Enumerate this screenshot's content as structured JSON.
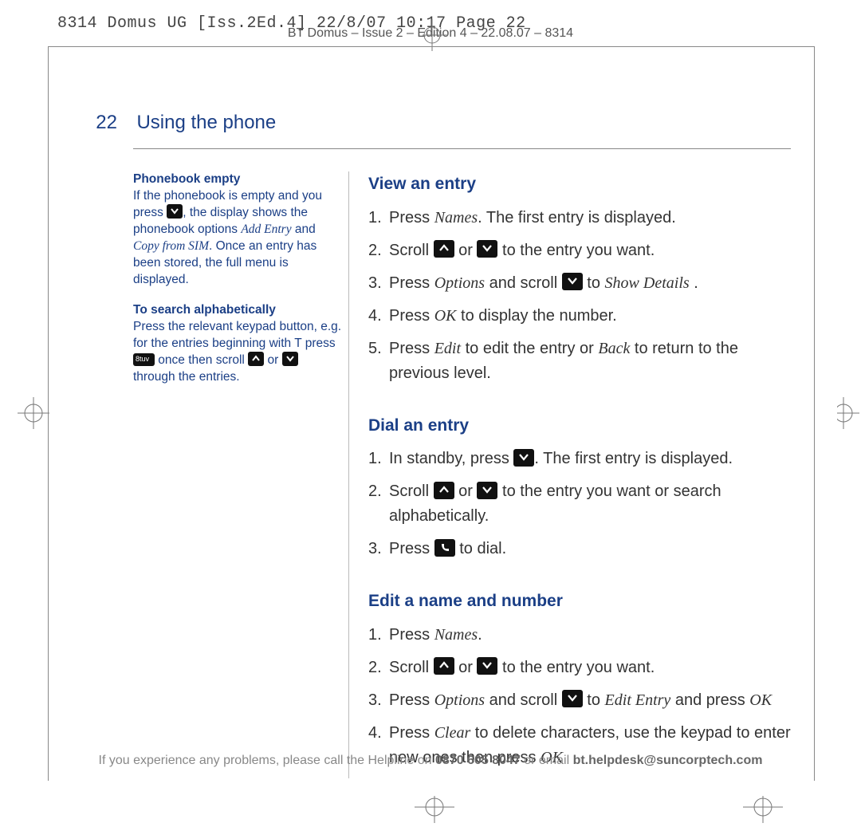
{
  "imposition": "8314 Domus UG [Iss.2Ed.4]  22/8/07  10:17  Page 22",
  "docline": "BT Domus – Issue 2 – Edition 4 – 22.08.07 – 8314",
  "page_number": "22",
  "section_title": "Using the phone",
  "sidebar": {
    "block1": {
      "heading": "Phonebook empty",
      "line1": "If the phonebook is empty and you press ",
      "line2": ", the display shows the phonebook options ",
      "opt1": "Add Entry",
      "and": " and ",
      "opt2": "Copy from SIM",
      "line3": ". Once an entry has been stored, the full menu is displayed."
    },
    "block2": {
      "heading": "To search alphabetically",
      "line1": "Press the relevant keypad button, e.g. for the entries beginning with T press ",
      "keylabel": "8tuv",
      "line2": " once then scroll ",
      "or": " or ",
      "line3": " through the entries."
    }
  },
  "main": {
    "view": {
      "heading": "View an entry",
      "s1a": "Press ",
      "s1b": "Names",
      "s1c": ". The first entry is displayed.",
      "s2a": "Scroll ",
      "s2or": " or ",
      "s2b": " to the entry you want.",
      "s3a": "Press ",
      "s3b": "Options",
      "s3c": " and scroll ",
      "s3d": " to ",
      "s3e": "Show Details",
      "s3f": " .",
      "s4a": "Press ",
      "s4b": "OK",
      "s4c": " to display the number.",
      "s5a": "Press ",
      "s5b": "Edit",
      "s5c": " to edit the entry or ",
      "s5d": "Back",
      "s5e": " to return to the previous level."
    },
    "dial": {
      "heading": "Dial an entry",
      "s1a": "In standby, press ",
      "s1b": ". The first entry is displayed.",
      "s2a": "Scroll ",
      "s2or": " or ",
      "s2b": " to the entry you want or search alphabetically.",
      "s3a": "Press ",
      "s3b": " to dial."
    },
    "edit": {
      "heading": "Edit a name and number",
      "s1a": "Press ",
      "s1b": "Names",
      "s1c": ".",
      "s2a": "Scroll ",
      "s2or": " or ",
      "s2b": " to the entry you want.",
      "s3a": "Press ",
      "s3b": "Options",
      "s3c": " and scroll ",
      "s3d": " to ",
      "s3e": "Edit Entry",
      "s3f": " and press ",
      "s3g": "OK",
      "s4a": "Press ",
      "s4b": "Clear",
      "s4c": " to delete characters, use the keypad to enter new ones then press ",
      "s4d": "OK"
    }
  },
  "nums": {
    "n1": "1.",
    "n2": "2.",
    "n3": "3.",
    "n4": "4.",
    "n5": "5."
  },
  "footer": {
    "a": "If you experience any problems, please call the Helpline on ",
    "phone": "0870 605 8047",
    "b": " or email ",
    "email": "bt.helpdesk@suncorptech.com"
  }
}
